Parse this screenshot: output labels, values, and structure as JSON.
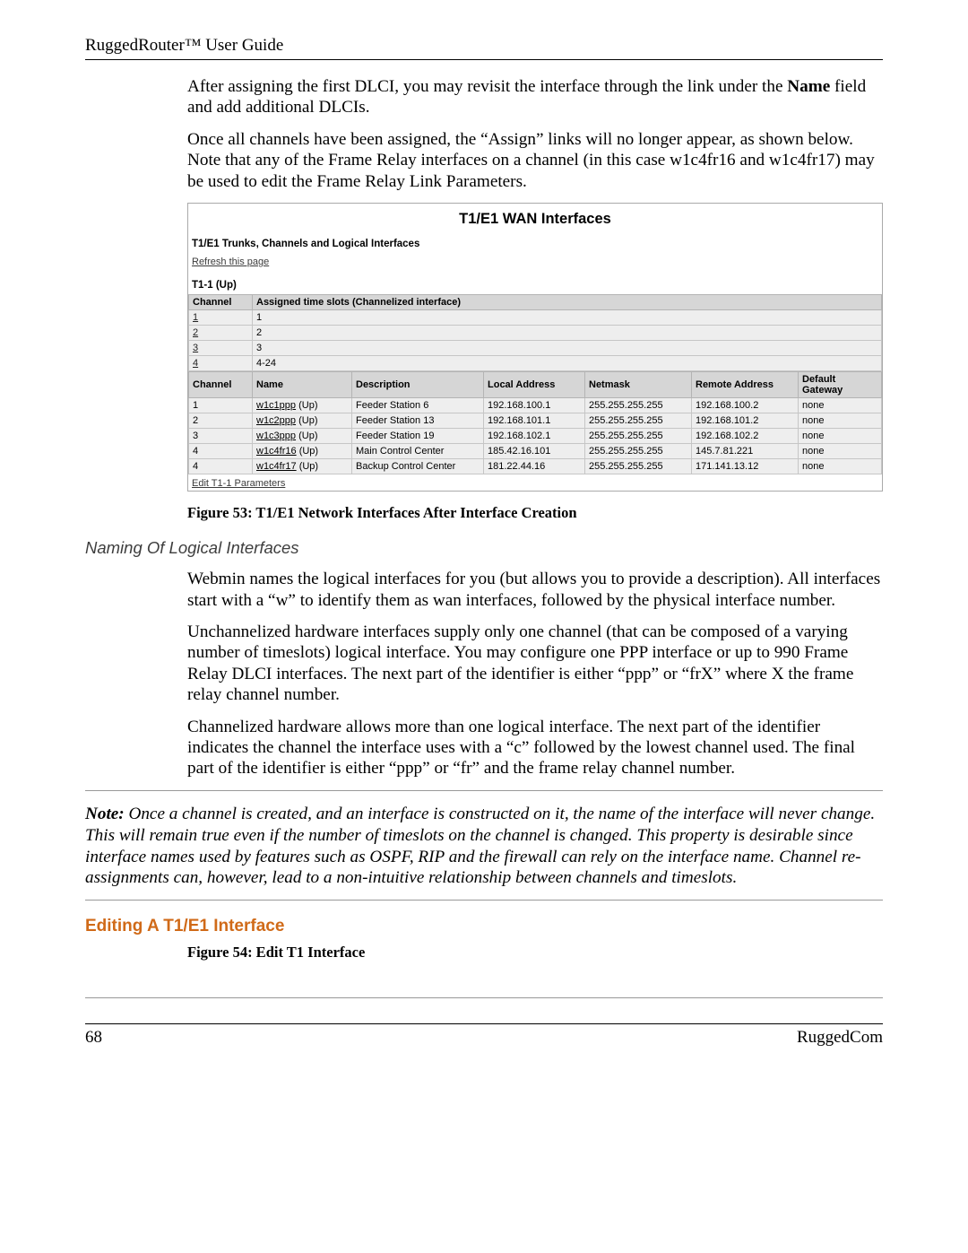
{
  "header": {
    "title": "RuggedRouter™ User Guide"
  },
  "para1": "After assigning the first DLCI, you may revisit the interface through the link under the ",
  "para1b": "Name",
  "para1c": " field and add additional DLCIs.",
  "para2": "Once all channels have been assigned, the “Assign” links will no longer appear, as shown below.  Note that any of the Frame Relay interfaces on a channel (in this case w1c4fr16 and w1c4fr17) may be used to edit the Frame Relay Link Parameters.",
  "figure53": {
    "title": "T1/E1 WAN Interfaces",
    "subtitle": "T1/E1 Trunks, Channels and Logical Interfaces",
    "refresh": "Refresh this page",
    "trunk": "T1-1 (Up)",
    "channels_header": [
      "Channel",
      "Assigned time slots (Channelized interface)"
    ],
    "channels": [
      {
        "ch": "1",
        "slots": "1"
      },
      {
        "ch": "2",
        "slots": "2"
      },
      {
        "ch": "3",
        "slots": "3"
      },
      {
        "ch": "4",
        "slots": "4-24"
      }
    ],
    "ifaces_header": [
      "Channel",
      "Name",
      "Description",
      "Local Address",
      "Netmask",
      "Remote Address",
      "Default Gateway"
    ],
    "ifaces": [
      {
        "ch": "1",
        "name": "w1c1ppp",
        "st": "(Up)",
        "desc": "Feeder Station 6",
        "local": "192.168.100.1",
        "mask": "255.255.255.255",
        "remote": "192.168.100.2",
        "gw": "none"
      },
      {
        "ch": "2",
        "name": "w1c2ppp",
        "st": "(Up)",
        "desc": "Feeder Station 13",
        "local": "192.168.101.1",
        "mask": "255.255.255.255",
        "remote": "192.168.101.2",
        "gw": "none"
      },
      {
        "ch": "3",
        "name": "w1c3ppp",
        "st": "(Up)",
        "desc": "Feeder Station 19",
        "local": "192.168.102.1",
        "mask": "255.255.255.255",
        "remote": "192.168.102.2",
        "gw": "none"
      },
      {
        "ch": "4",
        "name": "w1c4fr16",
        "st": "(Up)",
        "desc": "Main Control Center",
        "local": "185.42.16.101",
        "mask": "255.255.255.255",
        "remote": "145.7.81.221",
        "gw": "none"
      },
      {
        "ch": "4",
        "name": "w1c4fr17",
        "st": "(Up)",
        "desc": "Backup Control Center",
        "local": "181.22.44.16",
        "mask": "255.255.255.255",
        "remote": "171.141.13.12",
        "gw": "none"
      }
    ],
    "edit_link": "Edit T1-1 Parameters",
    "caption": "Figure 53: T1/E1 Network Interfaces After Interface Creation"
  },
  "sub_heading": "Naming Of Logical Interfaces",
  "para3": "Webmin names the logical interfaces for you (but allows you to provide a description).  All interfaces start with a “w” to identify them as wan interfaces, followed by the physical interface number.",
  "para4": "Unchannelized hardware interfaces supply only one channel (that can be composed of a varying number of timeslots) logical interface.  You may configure one PPP interface or up to 990 Frame Relay DLCI interfaces.  The next part of the identifier is either “ppp” or “frX” where X the frame relay channel number.",
  "para5": "Channelized hardware allows more than one logical interface.   The next part of the identifier indicates the channel the interface uses with a “c” followed by the lowest channel used.  The final part of the identifier is either “ppp” or “fr” and the frame relay channel number.",
  "note_label": "Note:",
  "note_body": "  Once a channel is created, and an interface is constructed on it, the name of the interface will never change.  This will remain true even if  the number of timeslots on the channel is changed.  This property is desirable since interface names used by features such as OSPF, RIP and the firewall can rely on the interface name.  Channel re-assignments can, however, lead to a non-intuitive relationship between channels and timeslots.",
  "main_heading": "Editing A T1/E1 Interface",
  "fig54_caption": "Figure 54: Edit T1 Interface",
  "footer": {
    "page": "68",
    "brand": "RuggedCom"
  }
}
